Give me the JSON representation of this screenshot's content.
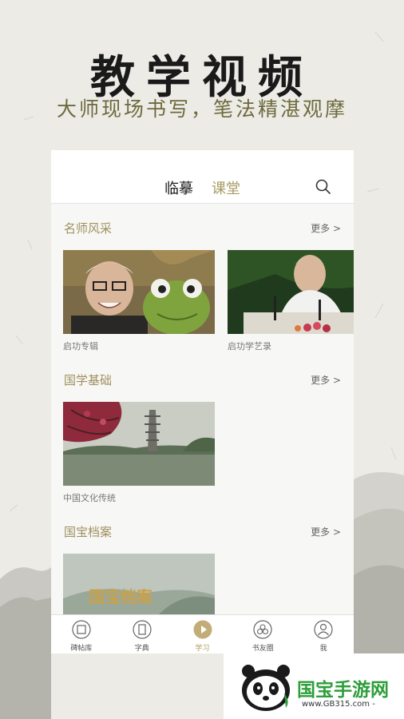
{
  "promo": {
    "title": "教学视频",
    "subtitle": "大师现场书写，笔法精湛观摩"
  },
  "tabs": {
    "active": "临摹",
    "inactive": "课堂"
  },
  "sections": {
    "masters": {
      "title": "名师风采",
      "more": "更多 >",
      "items": [
        {
          "caption": "启功专辑"
        },
        {
          "caption": "启功学艺录"
        }
      ]
    },
    "basics": {
      "title": "国学基础",
      "more": "更多 >",
      "items": [
        {
          "caption": "中国文化传统"
        }
      ]
    },
    "archives": {
      "title": "国宝档案",
      "more": "更多 >",
      "items": [
        {
          "overlay": "国宝档案"
        }
      ]
    }
  },
  "nav": [
    {
      "label": "碑帖库",
      "icon": "calligraphy-book-icon"
    },
    {
      "label": "字典",
      "icon": "dictionary-icon"
    },
    {
      "label": "学习",
      "icon": "play-icon",
      "active": true
    },
    {
      "label": "书友圈",
      "icon": "circle-icon"
    },
    {
      "label": "我",
      "icon": "user-icon"
    }
  ],
  "watermark": {
    "brand": "国宝手游网",
    "url": "www.GB315.com -"
  },
  "colors": {
    "accent": "#a89b62",
    "brand_green": "#2d9e3a"
  }
}
